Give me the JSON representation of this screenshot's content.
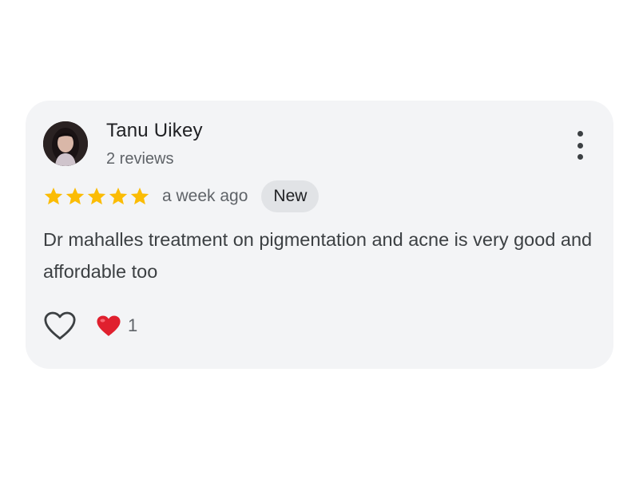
{
  "review": {
    "reviewer_name": "Tanu Uikey",
    "review_count": "2 reviews",
    "rating": 5,
    "rating_max": 5,
    "time_ago": "a week ago",
    "badge": "New",
    "text": "Dr mahalles treatment on pigmentation and acne is very good and affordable too",
    "reactions": {
      "like_icon": "heart-outline-icon",
      "reaction_icon": "red-heart-icon",
      "count": "1"
    },
    "more_icon": "more-vert-icon"
  },
  "colors": {
    "card_background": "#f3f4f6",
    "star": "#fbbc04",
    "badge_background": "#e1e3e6",
    "heart_red": "#e0202e"
  }
}
